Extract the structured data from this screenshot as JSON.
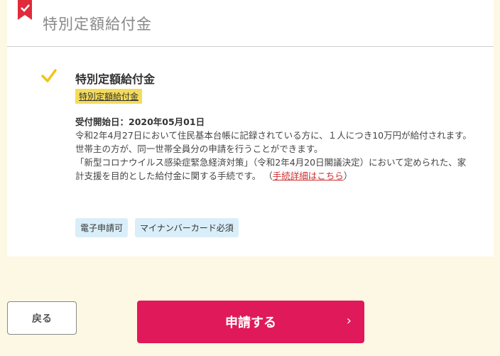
{
  "card": {
    "title": "特別定額給付金"
  },
  "item": {
    "title": "特別定額給付金",
    "tag": "特別定額給付金",
    "date_line": "受付開始日：2020年05月01日",
    "paragraph1": "令和2年4月27日において住民基本台帳に記録されている方に、１人につき10万円が給付されます。",
    "paragraph2": "世帯主の方が、同一世帯全員分の申請を行うことができます。",
    "paragraph3": "「新型コロナウイルス感染症緊急経済対策」（令和2年4月20日閣議決定）において定められた、家計支援を目的とした給付金に関する手続です。",
    "link_open": "（",
    "link_text": "手続詳細はこちら",
    "link_close": "）",
    "badges": [
      "電子申請可",
      "マイナンバーカード必須"
    ]
  },
  "buttons": {
    "back": "戻る",
    "apply": "申請する",
    "apply_chevron": "›"
  },
  "colors": {
    "background": "#fdf8e4",
    "accent": "#e0195a",
    "bookmark": "#e02b3a",
    "tag": "#f4dc5a",
    "badge": "#d9eef8",
    "check": "#f0c419"
  },
  "icons": {
    "bookmark": "bookmark-check-icon",
    "check": "checkmark-icon",
    "chevron": "chevron-right-icon"
  }
}
